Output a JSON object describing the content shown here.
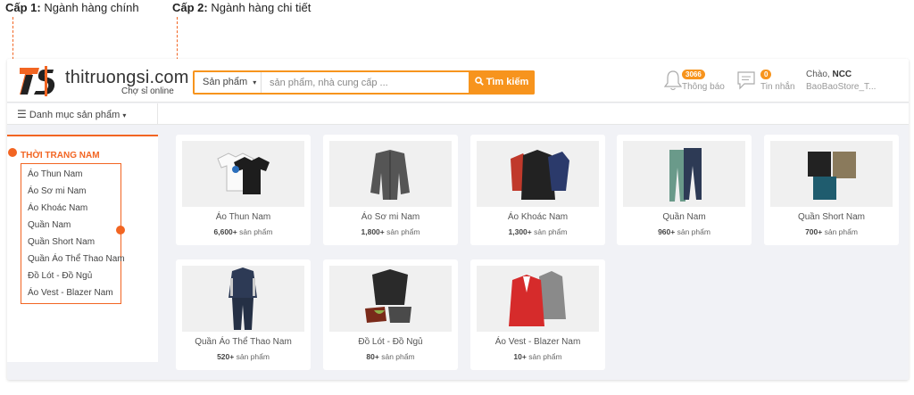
{
  "annotations": {
    "level1_prefix": "Cấp 1:",
    "level1_text": "Ngành hàng chính",
    "level2_prefix": "Cấp 2:",
    "level2_text": "Ngành hàng chi tiết"
  },
  "header": {
    "logo_text": "thitruongsi.com",
    "logo_sub": "Chợ sỉ online",
    "search": {
      "type_label": "Sản phẩm",
      "placeholder": "sản phẩm, nhà cung cấp ...",
      "button_label": "Tìm kiếm"
    },
    "notifications": {
      "badge": "3066",
      "label": "Thông báo"
    },
    "messages": {
      "badge": "0",
      "label": "Tin nhắn"
    },
    "greeting_prefix": "Chào,",
    "user_name": "NCC",
    "store_name": "BaoBaoStore_T..."
  },
  "category_menu": {
    "label": "Danh mục sản phẩm"
  },
  "sidebar": {
    "title": "THỜI TRANG NAM",
    "items": [
      "Áo Thun Nam",
      "Áo Sơ mi Nam",
      "Áo Khoác Nam",
      "Quần Nam",
      "Quần Short Nam",
      "Quần Áo Thể Thao Nam",
      "Đồ Lót - Đồ Ngủ",
      "Áo Vest - Blazer Nam"
    ]
  },
  "cards": [
    {
      "name": "Áo Thun Nam",
      "count": "6,600+",
      "unit": "sản phẩm"
    },
    {
      "name": "Áo Sơ mi Nam",
      "count": "1,800+",
      "unit": "sản phẩm"
    },
    {
      "name": "Áo Khoác Nam",
      "count": "1,300+",
      "unit": "sản phẩm"
    },
    {
      "name": "Quần Nam",
      "count": "960+",
      "unit": "sản phẩm"
    },
    {
      "name": "Quần Short Nam",
      "count": "700+",
      "unit": "sản phẩm"
    },
    {
      "name": "Quần Áo Thể Thao Nam",
      "count": "520+",
      "unit": "sản phẩm"
    },
    {
      "name": "Đồ Lót - Đồ Ngủ",
      "count": "80+",
      "unit": "sản phẩm"
    },
    {
      "name": "Áo Vest - Blazer Nam",
      "count": "10+",
      "unit": "sản phẩm"
    }
  ],
  "colors": {
    "accent": "#f26522",
    "button": "#f7941d",
    "background": "#f1f2f6"
  }
}
